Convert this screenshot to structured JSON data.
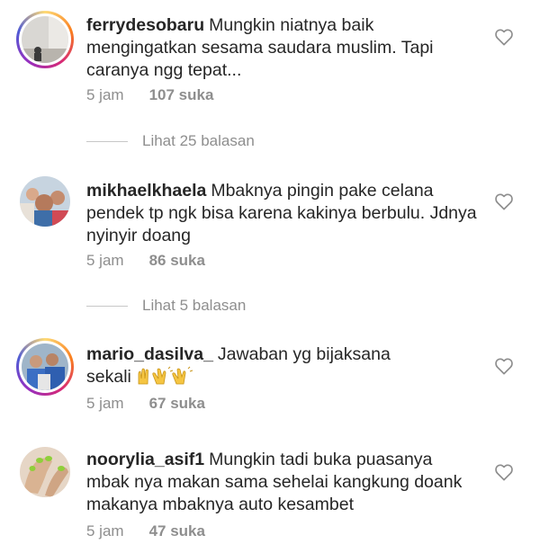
{
  "colors": {
    "text": "#262626",
    "meta": "#8e8e8e",
    "story_ring": [
      "#feda75",
      "#fa7e1e",
      "#d62976",
      "#962fbf",
      "#4f5bd5"
    ]
  },
  "comments": [
    {
      "username": "ferrydesobaru",
      "text_line1": "Mungkin niatnya baik",
      "text_rest": "mengingatkan sesama saudara muslim. Tapi caranya ngg tepat...",
      "time": "5 jam",
      "likes": "107 suka",
      "replies": "Lihat 25 balasan",
      "icon": "heart-outline-icon"
    },
    {
      "username": "mikhaelkhaela",
      "text_line1": "Mbaknya pingin pake celana",
      "text_rest": "pendek tp ngk bisa karena kakinya berbulu. Jdnya nyinyir doang",
      "time": "5 jam",
      "likes": "86 suka",
      "replies": "Lihat 5 balasan",
      "icon": "heart-outline-icon"
    },
    {
      "username": "mario_dasilva_",
      "text_line1": "Jawaban yg bijaksana",
      "text_rest": "sekali",
      "emojis": "🙌👏👏",
      "time": "5 jam",
      "likes": "67 suka",
      "icon": "heart-outline-icon"
    },
    {
      "username": "noorylia_asif1",
      "text_line1": "Mungkin tadi buka puasanya",
      "text_rest": "mbak nya makan sama sehelai kangkung doank  makanya mbaknya auto kesambet",
      "time": "5 jam",
      "likes": "47 suka",
      "icon": "heart-outline-icon"
    }
  ]
}
